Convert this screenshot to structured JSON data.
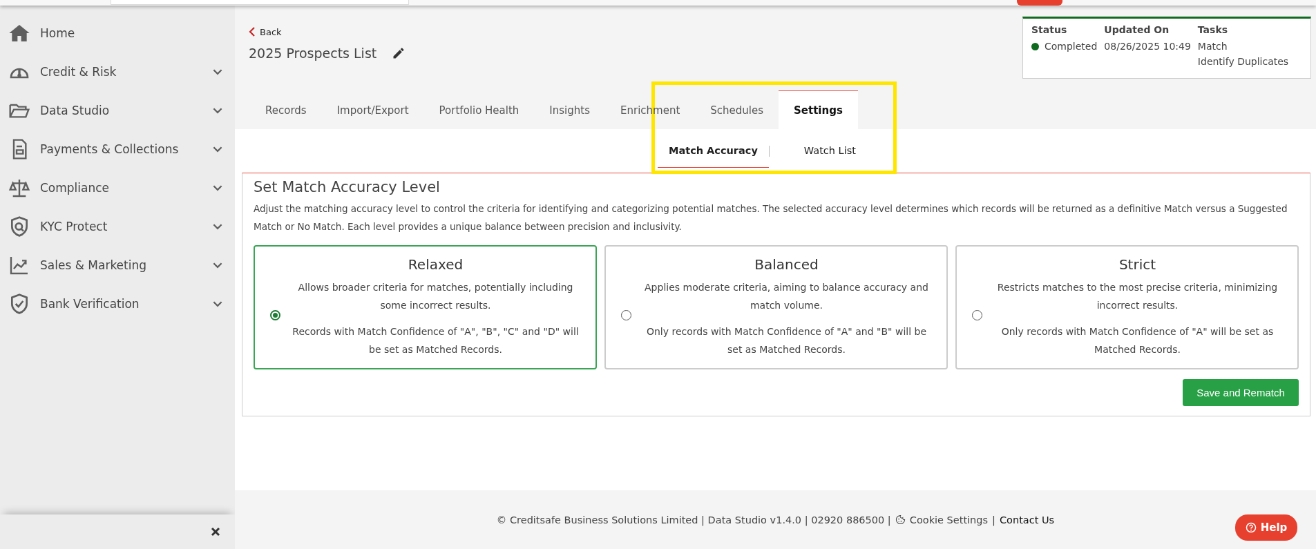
{
  "sidebar": {
    "items": [
      {
        "label": "Home",
        "expandable": false
      },
      {
        "label": "Credit & Risk",
        "expandable": true
      },
      {
        "label": "Data Studio",
        "expandable": true
      },
      {
        "label": "Payments & Collections",
        "expandable": true
      },
      {
        "label": "Compliance",
        "expandable": true
      },
      {
        "label": "KYC Protect",
        "expandable": true
      },
      {
        "label": "Sales & Marketing",
        "expandable": true
      },
      {
        "label": "Bank Verification",
        "expandable": true
      }
    ]
  },
  "back": "Back",
  "title": "2025 Prospects List",
  "status_card": {
    "status": {
      "heading": "Status",
      "value": "Completed",
      "color": "#0f6b1f"
    },
    "updated": {
      "heading": "Updated On",
      "value": "08/26/2025 10:49"
    },
    "tasks": {
      "heading": "Tasks",
      "values": [
        "Match",
        "Identify Duplicates"
      ]
    }
  },
  "tabs": [
    {
      "label": "Records",
      "selected": false
    },
    {
      "label": "Import/Export",
      "selected": false
    },
    {
      "label": "Portfolio Health",
      "selected": false
    },
    {
      "label": "Insights",
      "selected": false
    },
    {
      "label": "Enrichment",
      "selected": false
    },
    {
      "label": "Schedules",
      "selected": false
    },
    {
      "label": "Settings",
      "selected": true
    }
  ],
  "subtabs": [
    {
      "label": "Match Accuracy",
      "selected": true
    },
    {
      "label": "Watch List",
      "selected": false
    }
  ],
  "panel": {
    "title": "Set Match Accuracy Level",
    "description": "Adjust the matching accuracy level to control the criteria for identifying and categorizing potential matches. The selected accuracy level determines which records will be returned as a definitive Match versus a Suggested Match or No Match. Each level provides a unique balance between precision and inclusivity.",
    "options": [
      {
        "title": "Relaxed",
        "text": "Allows broader criteria for matches, potentially including some incorrect results.",
        "detail": "Records with Match Confidence of \"A\", \"B\", \"C\" and \"D\" will be set as Matched Records.",
        "selected": true
      },
      {
        "title": "Balanced",
        "text": "Applies moderate criteria, aiming to balance accuracy and match volume.",
        "detail": "Only records with Match Confidence of \"A\" and \"B\" will be set as Matched Records.",
        "selected": false
      },
      {
        "title": "Strict",
        "text": "Restricts matches to the most precise criteria, minimizing incorrect results.",
        "detail": "Only records with Match Confidence of \"A\" will be set as Matched Records.",
        "selected": false
      }
    ],
    "button": "Save and Rematch"
  },
  "footer": {
    "text": "© Creditsafe Business Solutions Limited | Data Studio v1.4.0 | 02920 886500 |",
    "cookie": "Cookie Settings",
    "separator": "|",
    "contact": "Contact Us"
  },
  "help": "Help"
}
